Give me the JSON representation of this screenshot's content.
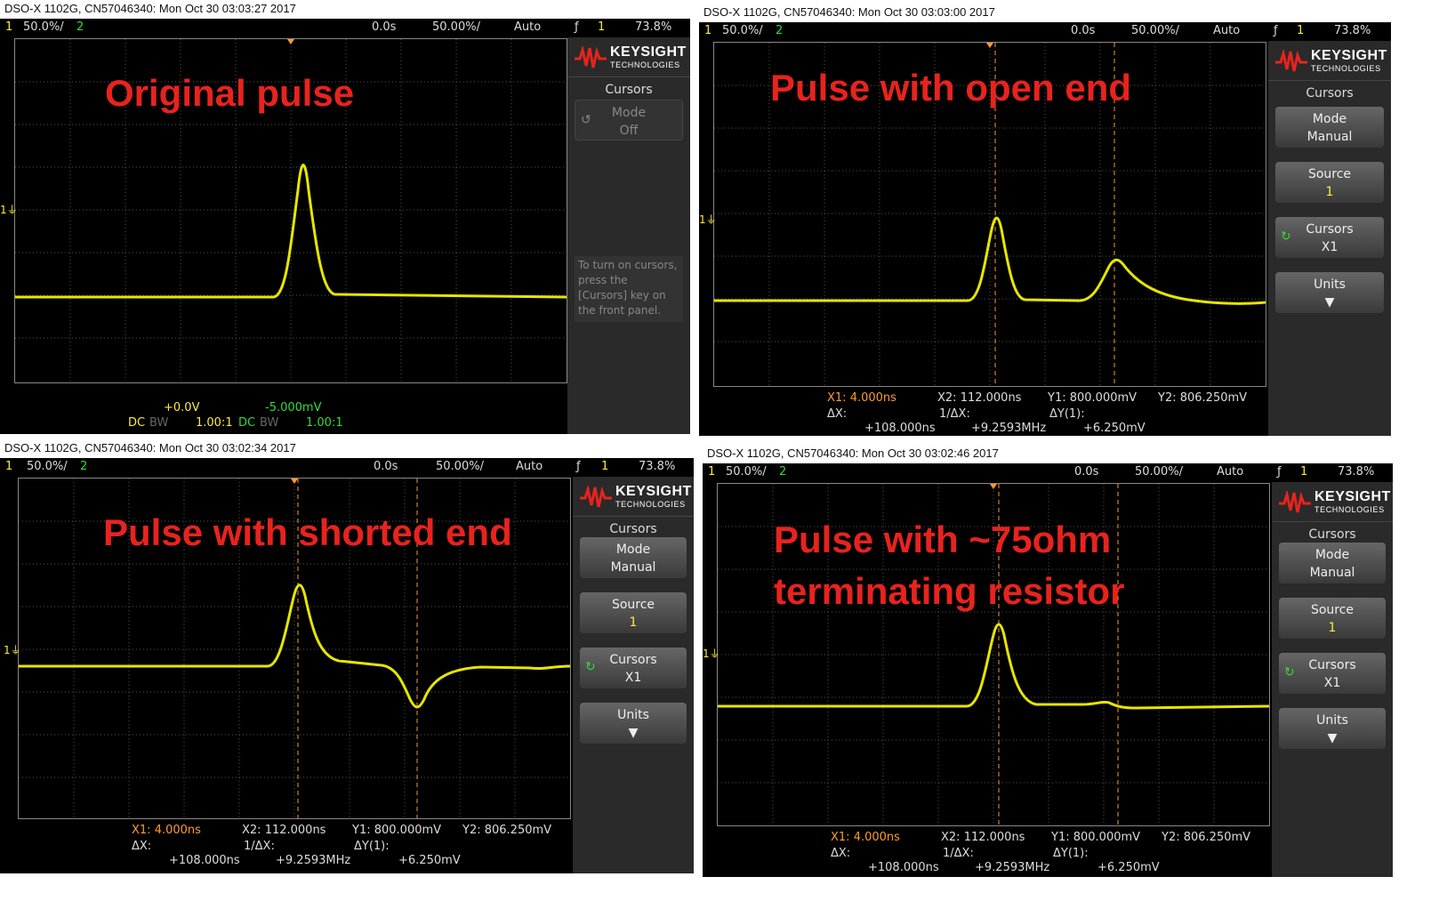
{
  "scopes": [
    {
      "header": "DSO-X 1102G, CN57046340: Mon Oct 30 03:03:27 2017",
      "status": {
        "ch1": "1",
        "ch1_scale": "50.0%/",
        "ch2": "2",
        "delay": "0.0s",
        "timebase": "50.00%/",
        "trigger_mode": "Auto",
        "trigger_icon": "ƒ",
        "trigger_ch": "1",
        "trigger_level": "73.8%"
      },
      "overlay": [
        "Original pulse"
      ],
      "panel": {
        "brand": "KEYSIGHT",
        "brand_sub": "TECHNOLOGIES",
        "title": "Cursors",
        "mode_label": "Mode",
        "mode_value": "Off",
        "help": "To turn on cursors, press the [Cursors] key on the front panel."
      },
      "bottom": {
        "offset1": "+0.0V",
        "offset2": "-5.000mV",
        "dc1": "DC",
        "bw1": "BW",
        "probe1": "1.00:1",
        "dc2": "DC",
        "bw2": "BW",
        "probe2": "1.00:1"
      }
    },
    {
      "header": "DSO-X 1102G, CN57046340: Mon Oct 30 03:03:00 2017",
      "status": {
        "ch1": "1",
        "ch1_scale": "50.0%/",
        "ch2": "2",
        "delay": "0.0s",
        "timebase": "50.00%/",
        "trigger_mode": "Auto",
        "trigger_icon": "ƒ",
        "trigger_ch": "1",
        "trigger_level": "73.8%"
      },
      "overlay": [
        "Pulse with open end"
      ],
      "panel": {
        "brand": "KEYSIGHT",
        "brand_sub": "TECHNOLOGIES",
        "title": "Cursors",
        "mode_label": "Mode",
        "mode_value": "Manual",
        "source_label": "Source",
        "source_value": "1",
        "cursors_label": "Cursors",
        "cursors_value": "X1",
        "units_label": "Units"
      },
      "measurements": {
        "x1": "X1:  4.000ns",
        "x2": "X2:  112.000ns",
        "y1": "Y1:  800.000mV",
        "y2": "Y2:  806.250mV",
        "dx_label": "ΔX:",
        "dx": "+108.000ns",
        "inv_label": "1/ΔX:",
        "inv": "+9.2593MHz",
        "dy_label": "ΔY(1):",
        "dy": "+6.250mV"
      }
    },
    {
      "header": "DSO-X 1102G, CN57046340: Mon Oct 30 03:02:34 2017",
      "status": {
        "ch1": "1",
        "ch1_scale": "50.0%/",
        "ch2": "2",
        "delay": "0.0s",
        "timebase": "50.00%/",
        "trigger_mode": "Auto",
        "trigger_icon": "ƒ",
        "trigger_ch": "1",
        "trigger_level": "73.8%"
      },
      "overlay": [
        "Pulse with shorted end"
      ],
      "panel": {
        "brand": "KEYSIGHT",
        "brand_sub": "TECHNOLOGIES",
        "title": "Cursors",
        "mode_label": "Mode",
        "mode_value": "Manual",
        "source_label": "Source",
        "source_value": "1",
        "cursors_label": "Cursors",
        "cursors_value": "X1",
        "units_label": "Units"
      },
      "measurements": {
        "x1": "X1:  4.000ns",
        "x2": "X2:  112.000ns",
        "y1": "Y1:  800.000mV",
        "y2": "Y2:  806.250mV",
        "dx_label": "ΔX:",
        "dx": "+108.000ns",
        "inv_label": "1/ΔX:",
        "inv": "+9.2593MHz",
        "dy_label": "ΔY(1):",
        "dy": "+6.250mV"
      }
    },
    {
      "header": "DSO-X 1102G, CN57046340: Mon Oct 30 03:02:46 2017",
      "status": {
        "ch1": "1",
        "ch1_scale": "50.0%/",
        "ch2": "2",
        "delay": "0.0s",
        "timebase": "50.00%/",
        "trigger_mode": "Auto",
        "trigger_icon": "ƒ",
        "trigger_ch": "1",
        "trigger_level": "73.8%"
      },
      "overlay": [
        "Pulse with ~75ohm",
        "terminating resistor"
      ],
      "panel": {
        "brand": "KEYSIGHT",
        "brand_sub": "TECHNOLOGIES",
        "title": "Cursors",
        "mode_label": "Mode",
        "mode_value": "Manual",
        "source_label": "Source",
        "source_value": "1",
        "cursors_label": "Cursors",
        "cursors_value": "X1",
        "units_label": "Units"
      },
      "measurements": {
        "x1": "X1:  4.000ns",
        "x2": "X2:  112.000ns",
        "y1": "Y1:  800.000mV",
        "y2": "Y2:  806.250mV",
        "dx_label": "ΔX:",
        "dx": "+108.000ns",
        "inv_label": "1/ΔX:",
        "inv": "+9.2593MHz",
        "dy_label": "ΔY(1):",
        "dy": "+6.250mV"
      }
    }
  ],
  "colors": {
    "trace": "#e6e600",
    "cursor": "#ff9a2e",
    "overlay_text": "#e8231e",
    "ch1": "#ffeb3b",
    "ch2": "#33dd33"
  }
}
